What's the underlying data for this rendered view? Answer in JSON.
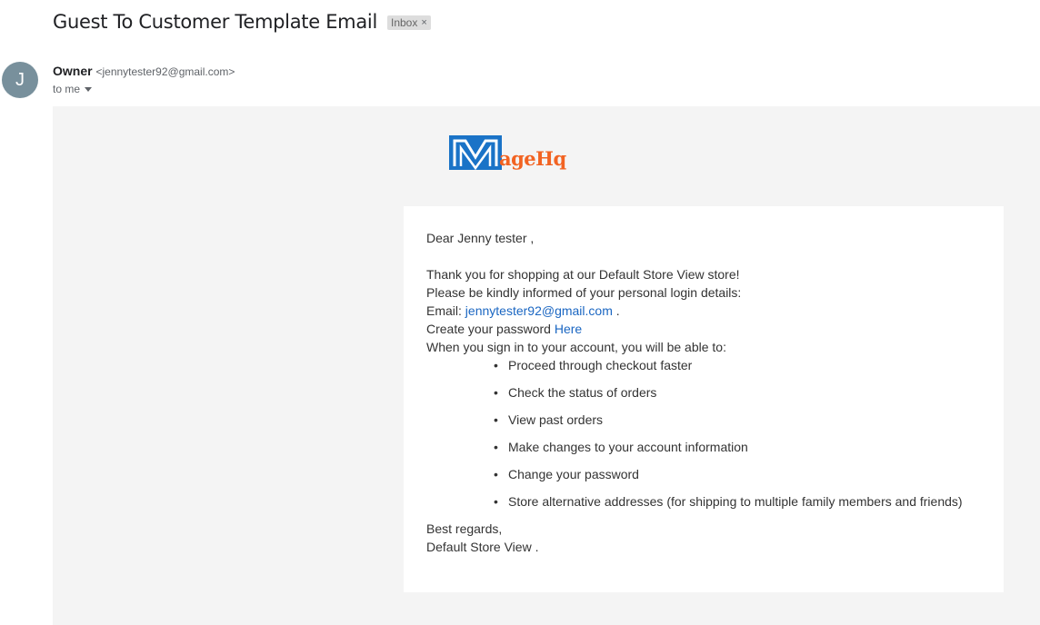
{
  "subject": "Guest To Customer Template Email",
  "label": {
    "text": "Inbox",
    "remove": "×"
  },
  "sender": {
    "avatar_letter": "J",
    "name": "Owner",
    "email": "<jennytester92@gmail.com>",
    "to": "to me"
  },
  "logo": {
    "text": "ageHq",
    "letter": "M",
    "colors": {
      "blue": "#1a73c7",
      "orange": "#f26322"
    }
  },
  "body": {
    "greeting": "Dear Jenny tester ,",
    "thanks": "Thank you for shopping at our Default Store View store!",
    "informed": "Please be kindly informed of your personal login details:",
    "email_label": "Email:",
    "email_value": "jennytester92@gmail.com",
    "email_suffix": " .",
    "password_prefix": "Create your password",
    "password_link": "Here",
    "signin_intro": "When you sign in to your account, you will be able to:",
    "benefits": [
      "Proceed through checkout faster",
      "Check the status of orders",
      "View past orders",
      "Make changes to your account information",
      "Change your password",
      "Store alternative addresses (for shipping to multiple family members and friends)"
    ],
    "regards": "Best regards,",
    "store": "Default Store View ."
  }
}
